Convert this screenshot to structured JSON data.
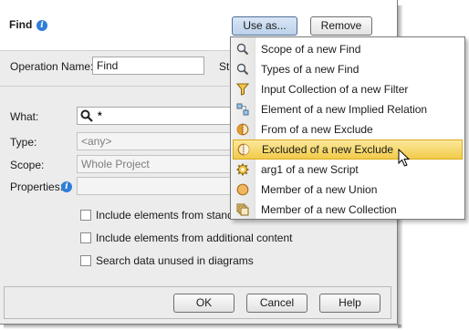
{
  "dialog": {
    "title": "Find",
    "buttons": {
      "use_as": "Use as...",
      "remove": "Remove"
    },
    "fields": {
      "operation_name": {
        "label": "Operation Name:",
        "value": "Find"
      },
      "st_label": "St",
      "what": {
        "label": "What:",
        "value": "*"
      },
      "type": {
        "label": "Type:",
        "value": "<any>"
      },
      "scope": {
        "label": "Scope:",
        "value": "Whole Project"
      },
      "properties": {
        "label": "Properties:",
        "value": ""
      }
    },
    "checkboxes": [
      {
        "label": "Include elements from standard",
        "checked": false
      },
      {
        "label": "Include elements from additional content",
        "checked": false
      },
      {
        "label": "Search data unused in diagrams",
        "checked": false
      }
    ],
    "footer": {
      "ok": "OK",
      "cancel": "Cancel",
      "help": "Help"
    }
  },
  "menu": {
    "items": [
      {
        "label": "Scope of a new Find",
        "icon": "magnifier-icon"
      },
      {
        "label": "Types of a new Find",
        "icon": "magnifier-icon"
      },
      {
        "label": "Input Collection of a new Filter",
        "icon": "filter-icon"
      },
      {
        "label": "Element of a new Implied Relation",
        "icon": "relation-icon"
      },
      {
        "label": "From of a new Exclude",
        "icon": "exclude-icon"
      },
      {
        "label": "Excluded of a new Exclude",
        "icon": "exclude-icon",
        "selected": true
      },
      {
        "label": "arg1 of a new Script",
        "icon": "gear-icon"
      },
      {
        "label": "Member of a new Union",
        "icon": "union-icon"
      },
      {
        "label": "Member of a new Collection",
        "icon": "collection-icon"
      }
    ]
  },
  "colors": {
    "info_blue": "#2f7ed8",
    "highlight": "#f2cb4a",
    "accent_orange": "#e59a2b"
  }
}
